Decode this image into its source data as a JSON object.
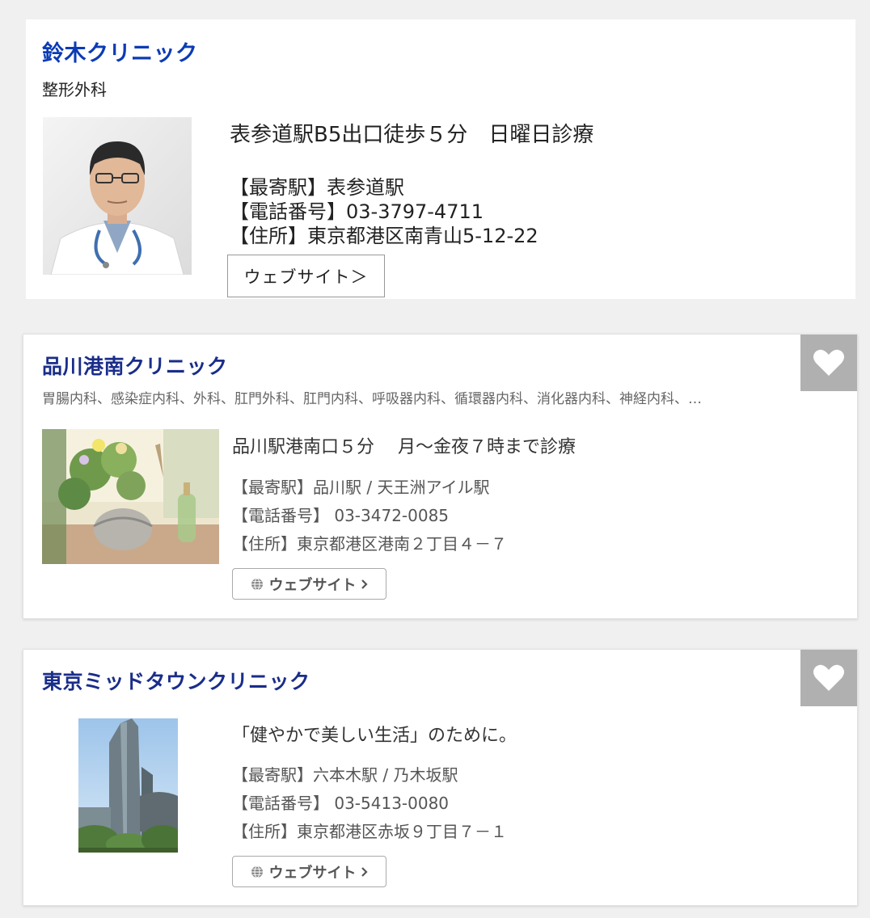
{
  "clinics": [
    {
      "name": "鈴木クリニック",
      "departments": "整形外科",
      "headline": "表参道駅B5出口徒歩５分　日曜日診療",
      "station": "【最寄駅】表参道駅",
      "phone": "【電話番号】03-3797-4711",
      "address": "【住所】東京都港区南青山5-12-22",
      "website_label": "ウェブサイト＞"
    },
    {
      "name": "品川港南クリニック",
      "departments": "胃腸内科、感染症内科、外科、肛門外科、肛門内科、呼吸器内科、循環器内科、消化器内科、神経内科、…",
      "headline": "品川駅港南口５分　 月～金夜７時まで診療",
      "station": "【最寄駅】品川駅 / 天王洲アイル駅",
      "phone": "【電話番号】 03-3472-0085",
      "address": "【住所】東京都港区港南２丁目４－７",
      "website_label": "ウェブサイト"
    },
    {
      "name": "東京ミッドタウンクリニック",
      "headline": "「健やかで美しい生活」のために。",
      "station": "【最寄駅】六本木駅 / 乃木坂駅",
      "phone": "【電話番号】 03-5413-0080",
      "address": "【住所】東京都港区赤坂９丁目７－１",
      "website_label": "ウェブサイト"
    }
  ],
  "colors": {
    "name_primary": "#0b3bb5",
    "name_secondary": "#1a2d8a",
    "favorite_bg": "#b0b0b0"
  },
  "icons": {
    "favorite": "heart-icon",
    "website": "globe-icon",
    "chevron": "chevron-right-icon"
  }
}
